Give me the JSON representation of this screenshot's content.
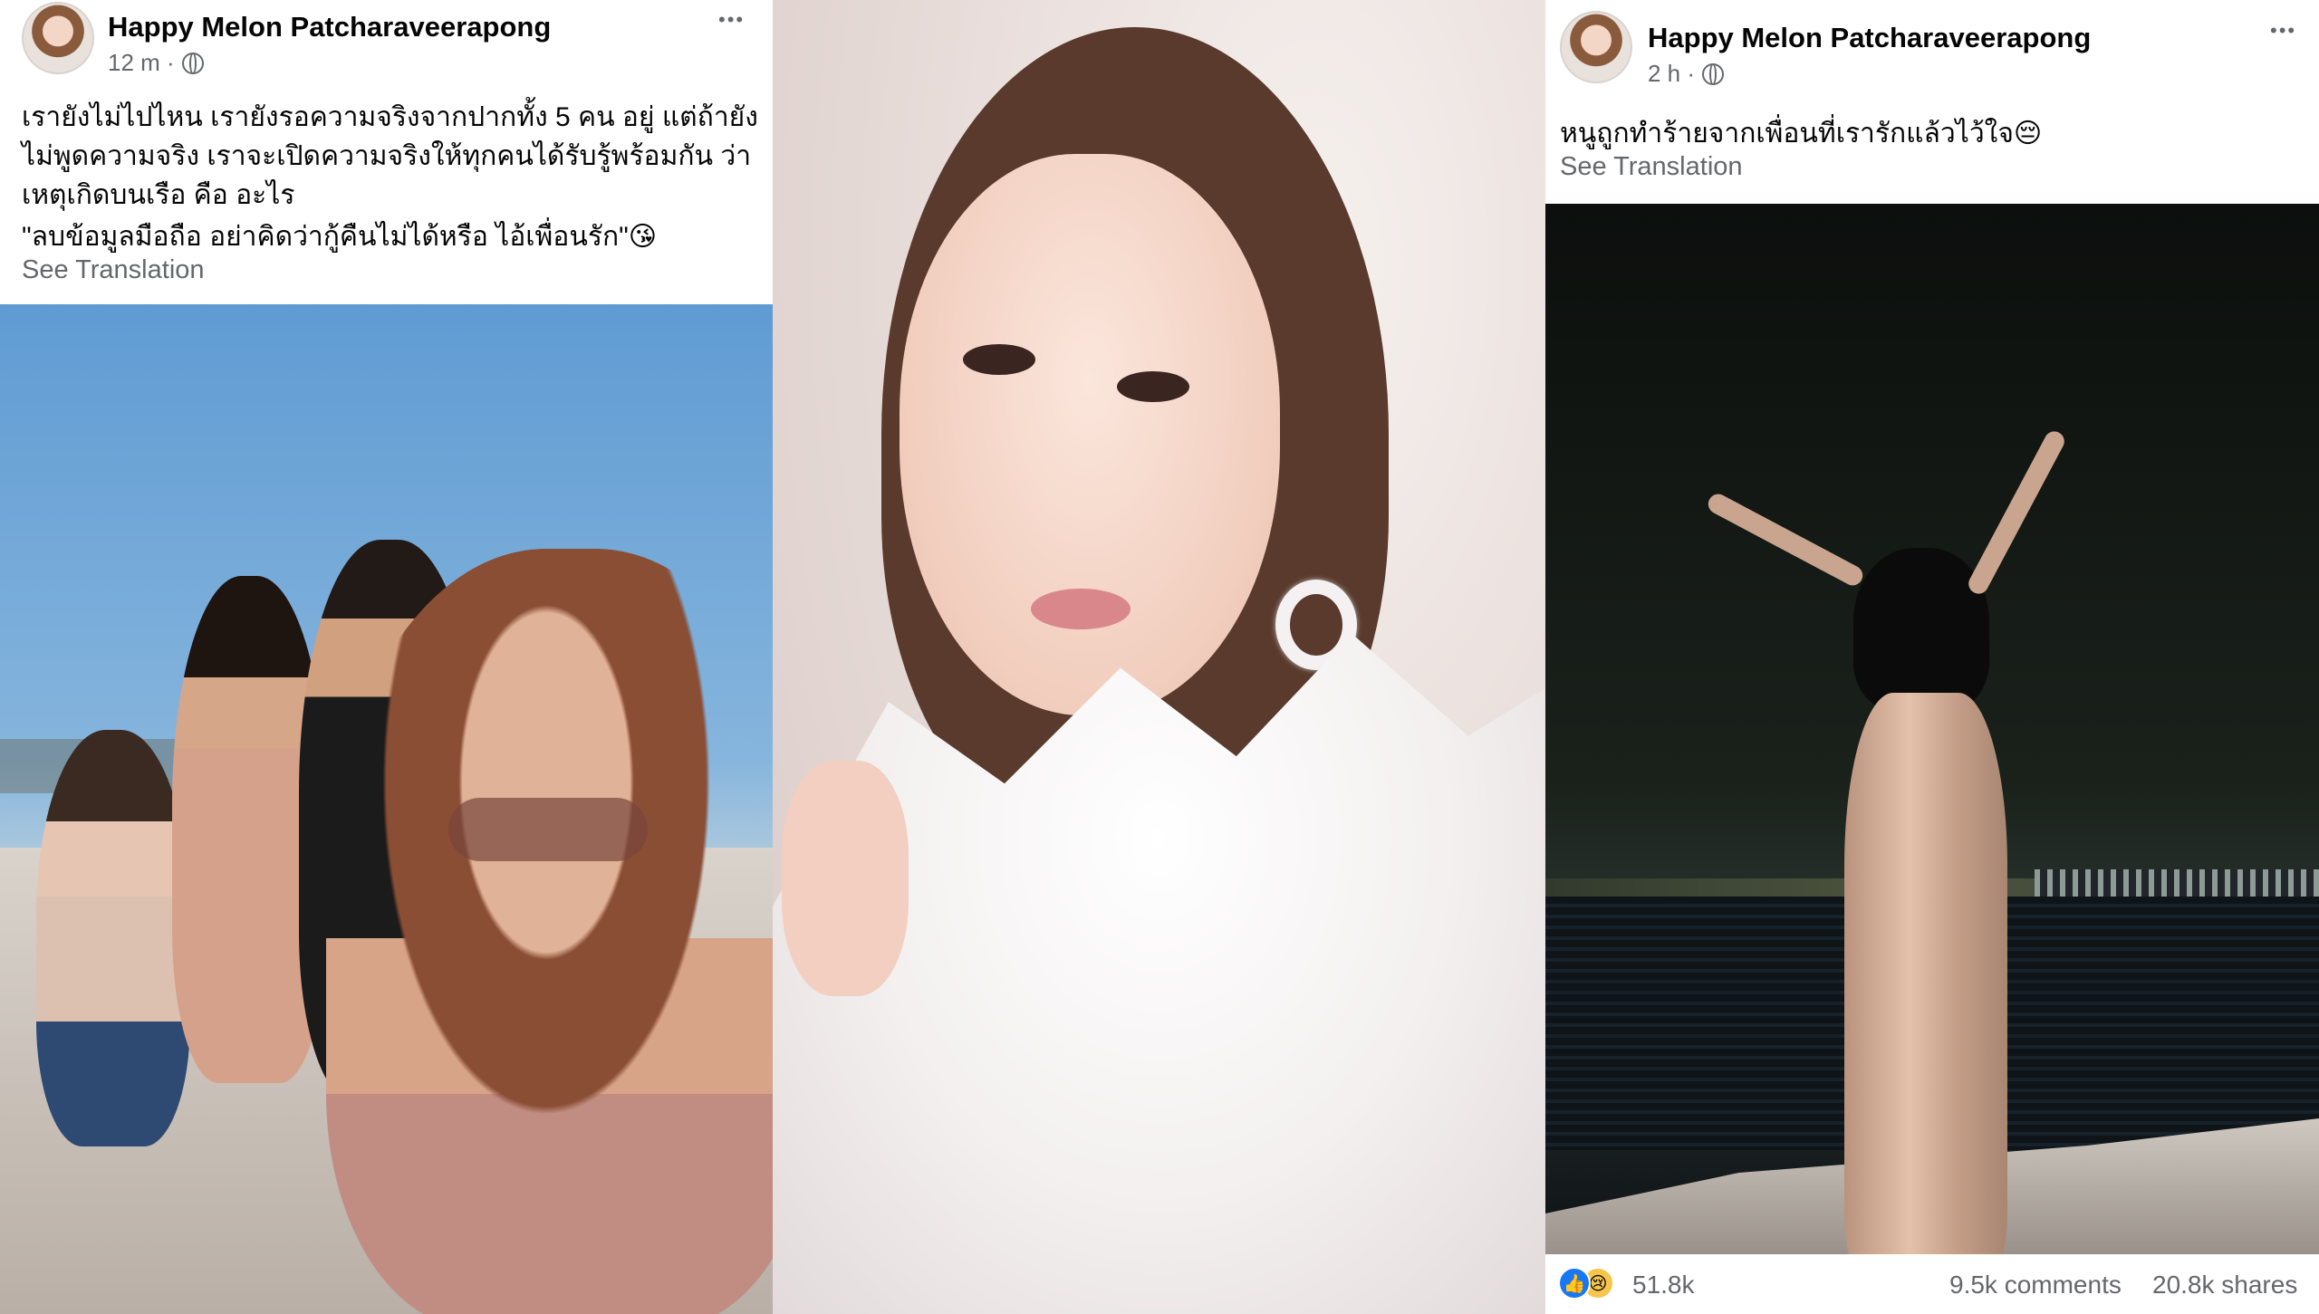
{
  "left_post": {
    "author": "Happy Melon Patcharaveerapong",
    "time": "12 m ·",
    "more": "•••",
    "lines": [
      "เรายังไม่ไปไหน  เรายังรอความจริงจากปากทั้ง 5 คน อยู่ แต่ถ้ายัง",
      "ไม่พูดความจริง เราจะเปิดความจริงให้ทุกคนได้รับรู้พร้อมกัน  ว่า",
      "เหตุเกิดบนเรือ  คือ อะไร",
      "\"ลบข้อมูลมือถือ อย่าคิดว่ากู้คืนไม่ได้หรือ ไอ้เพื่อนรัก\"😘"
    ],
    "see_translation": "See Translation"
  },
  "right_post": {
    "author": "Happy Melon Patcharaveerapong",
    "time": "2 h ·",
    "more": "•••",
    "line": "หนูถูกทำร้ายจากเพื่อนที่เรารักแล้วไว้ใจ😔",
    "see_translation": "See Translation",
    "reaction_count": "51.8k",
    "comments": "9.5k comments",
    "shares": "20.8k shares",
    "like_glyph": "👍",
    "sad_glyph": "😢"
  },
  "colors": {
    "text": "#050505",
    "secondary": "#65676b",
    "like_blue": "#1877f2",
    "sad_yellow": "#f7c54c"
  }
}
